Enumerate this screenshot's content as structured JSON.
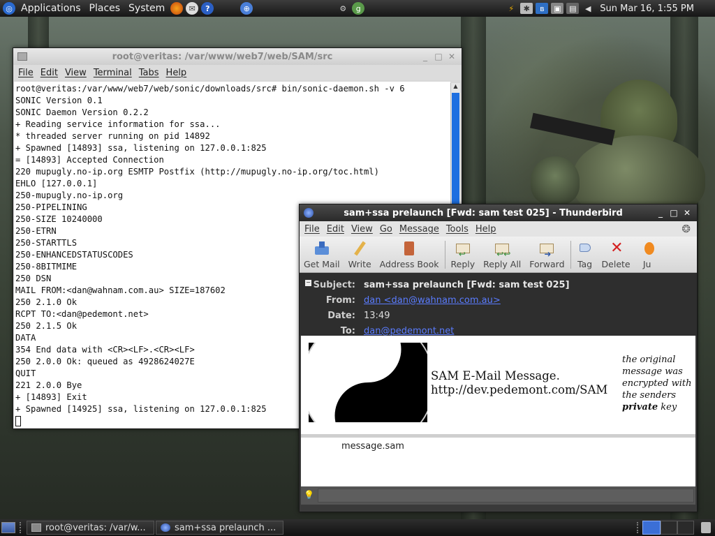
{
  "top_panel": {
    "menus": [
      "Applications",
      "Places",
      "System"
    ],
    "clock": "Sun Mar 16,  1:55 PM"
  },
  "terminal": {
    "title": "root@veritas: /var/www/web7/web/SAM/src",
    "menu": [
      "File",
      "Edit",
      "View",
      "Terminal",
      "Tabs",
      "Help"
    ],
    "lines": [
      "root@veritas:/var/www/web7/web/sonic/downloads/src# bin/sonic-daemon.sh -v 6",
      "SONIC Version 0.1",
      "SONIC Daemon Version 0.2.2",
      "+ Reading service information for ssa...",
      "* threaded server running on pid 14892",
      "+ Spawned [14893] ssa, listening on 127.0.0.1:825",
      "= [14893] Accepted Connection",
      "220 mupugly.no-ip.org ESMTP Postfix (http://mupugly.no-ip.org/toc.html)",
      "EHLO [127.0.0.1]",
      "250-mupugly.no-ip.org",
      "250-PIPELINING",
      "250-SIZE 10240000",
      "250-ETRN",
      "250-STARTTLS",
      "250-ENHANCEDSTATUSCODES",
      "250-8BITMIME",
      "250 DSN",
      "MAIL FROM:<dan@wahnam.com.au> SIZE=187602",
      "250 2.1.0 Ok",
      "RCPT TO:<dan@pedemont.net>",
      "250 2.1.5 Ok",
      "DATA",
      "354 End data with <CR><LF>.<CR><LF>",
      "250 2.0.0 Ok: queued as 4928624027E",
      "QUIT",
      "221 2.0.0 Bye",
      "+ [14893] Exit",
      "+ Spawned [14925] ssa, listening on 127.0.0.1:825"
    ]
  },
  "thunderbird": {
    "title": "sam+ssa prelaunch [Fwd: sam test 025] - Thunderbird",
    "menu": [
      "File",
      "Edit",
      "View",
      "Go",
      "Message",
      "Tools",
      "Help"
    ],
    "toolbar": {
      "get_mail": "Get Mail",
      "write": "Write",
      "address_book": "Address Book",
      "reply": "Reply",
      "reply_all": "Reply All",
      "forward": "Forward",
      "tag": "Tag",
      "delete": "Delete",
      "junk": "Ju"
    },
    "headers": {
      "subject_label": "Subject:",
      "subject": "sam+ssa prelaunch [Fwd: sam test 025]",
      "from_label": "From:",
      "from": "dan <dan@wahnam.com.au>",
      "date_label": "Date:",
      "date": "13:49",
      "to_label": "To:",
      "to": "dan@pedemont.net"
    },
    "body": {
      "line1": "SAM E-Mail Message.",
      "line2": "http://dev.pedemont.com/SAM",
      "note_1": "the original",
      "note_2": "message was",
      "note_3": "encrypted with",
      "note_4": "the senders",
      "note_bold": "private",
      "note_5": " key"
    },
    "attachment": "message.sam"
  },
  "taskbar": {
    "task_terminal": "root@veritas: /var/w...",
    "task_thunderbird": "sam+ssa prelaunch ..."
  }
}
